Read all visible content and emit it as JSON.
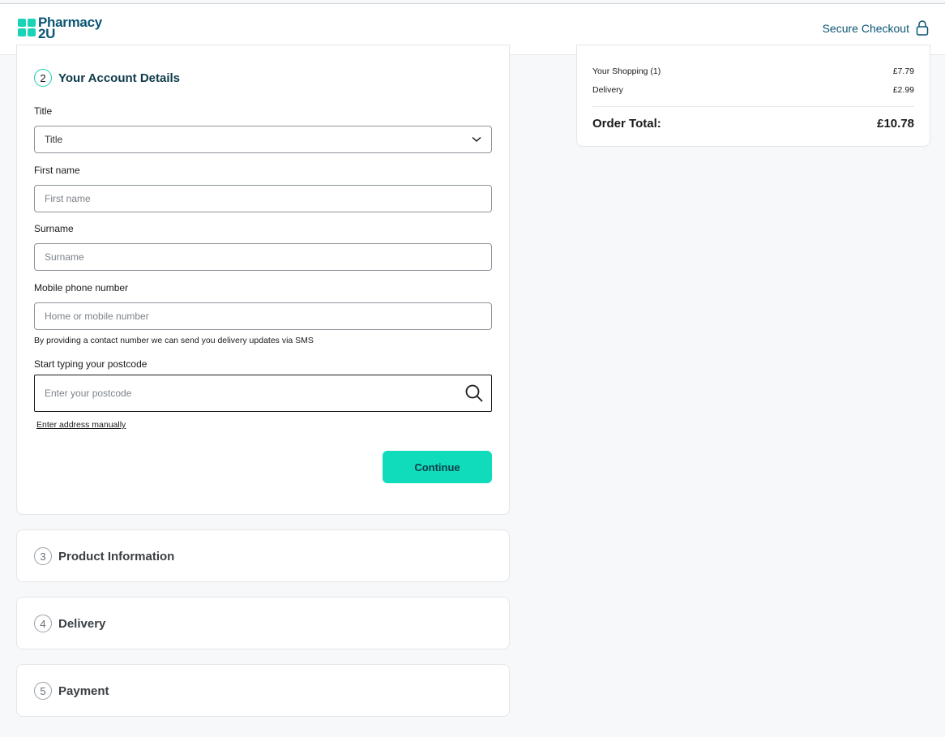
{
  "header": {
    "logo_line1": "Pharmacy",
    "logo_line2": "2U",
    "secure_label": "Secure Checkout",
    "logo_color": "#0b5575",
    "accent_color": "#19d3b7"
  },
  "account_details": {
    "step_number": "2",
    "title": "Your Account Details",
    "title_field": {
      "label": "Title",
      "value": "Title"
    },
    "first_name": {
      "label": "First name",
      "placeholder": "First name"
    },
    "surname": {
      "label": "Surname",
      "placeholder": "Surname"
    },
    "mobile": {
      "label": "Mobile phone number",
      "placeholder": "Home or mobile number",
      "hint": "By providing a contact number we can send you delivery updates via SMS"
    },
    "postcode": {
      "label": "Start typing your postcode",
      "placeholder": "Enter your postcode"
    },
    "manual_link": "Enter address manually",
    "continue_label": "Continue",
    "button_color": "#10dcbb"
  },
  "steps": [
    {
      "number": "3",
      "title": "Product Information"
    },
    {
      "number": "4",
      "title": "Delivery"
    },
    {
      "number": "5",
      "title": "Payment"
    }
  ],
  "summary": {
    "shopping_label": "Your Shopping (1)",
    "shopping_value": "£7.79",
    "delivery_label": "Delivery",
    "delivery_value": "£2.99",
    "total_label": "Order Total:",
    "total_value": "£10.78"
  }
}
